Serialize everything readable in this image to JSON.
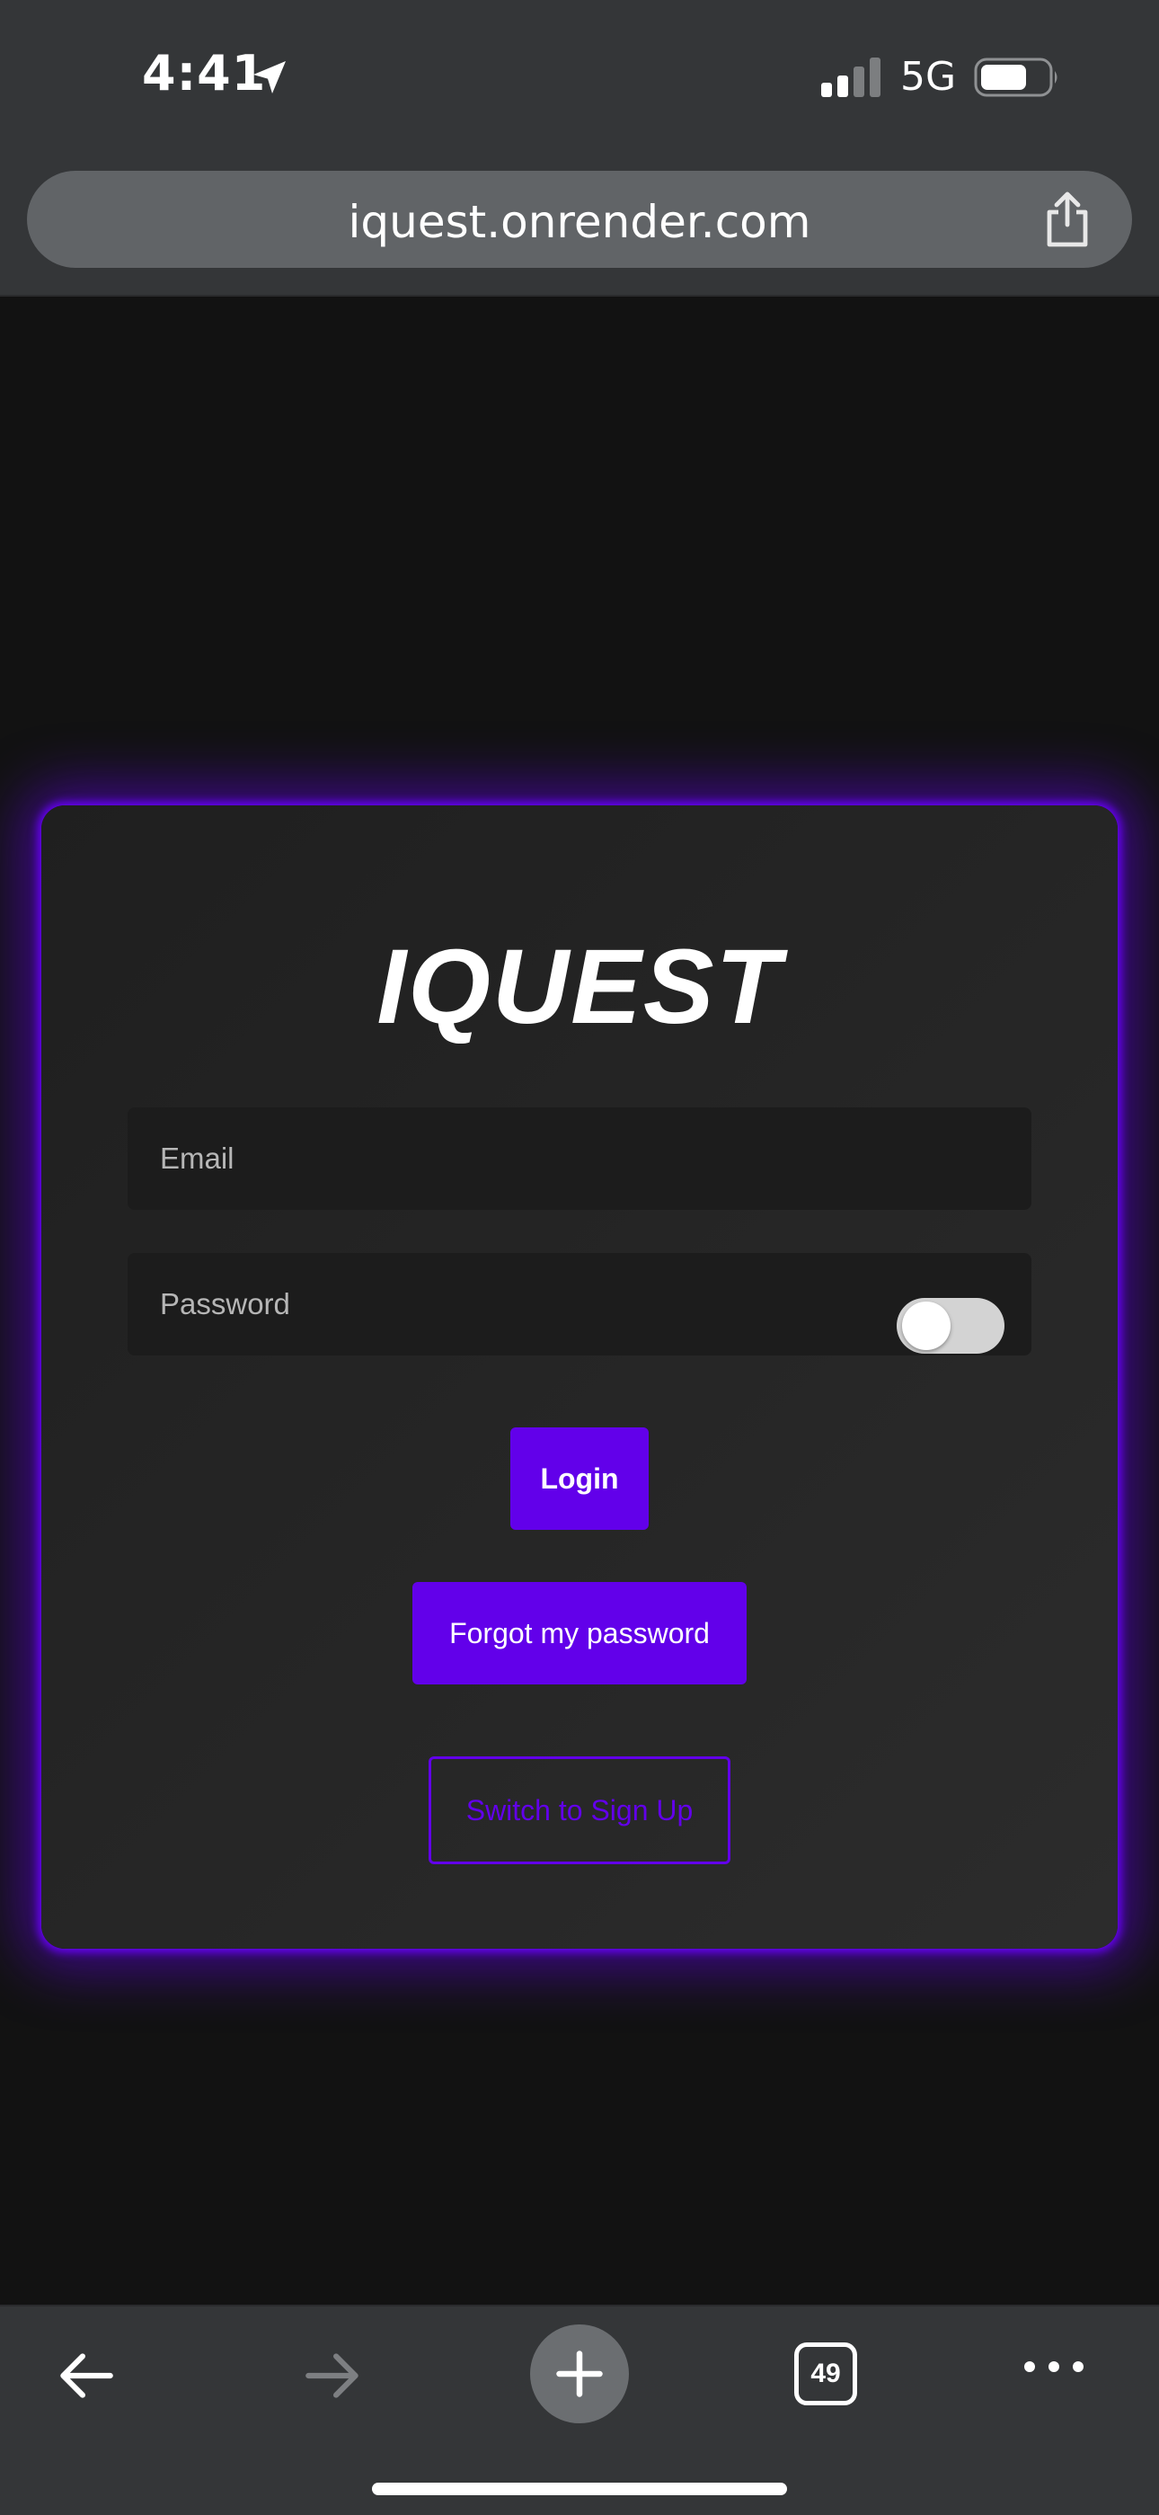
{
  "status_bar": {
    "time": "4:41",
    "network": "5G",
    "icons": [
      "location-arrow-icon",
      "signal-icon",
      "battery-icon"
    ]
  },
  "browser": {
    "url": "iquest.onrender.com",
    "share_icon": "share-icon",
    "toolbar": {
      "tab_count": "49",
      "icons": [
        "back-arrow-icon",
        "forward-arrow-icon",
        "plus-icon",
        "tabs-icon",
        "more-icon"
      ]
    }
  },
  "login": {
    "title": "IQUEST",
    "email_placeholder": "Email",
    "password_placeholder": "Password",
    "password_visibility_toggle": "off",
    "login_label": "Login",
    "forgot_label": "Forgot my password",
    "switch_label": "Switch to Sign Up"
  },
  "colors": {
    "accent": "#6200ea",
    "background": "#121212",
    "card": "#262626",
    "chrome": "#343638",
    "url_pill": "#616467"
  }
}
